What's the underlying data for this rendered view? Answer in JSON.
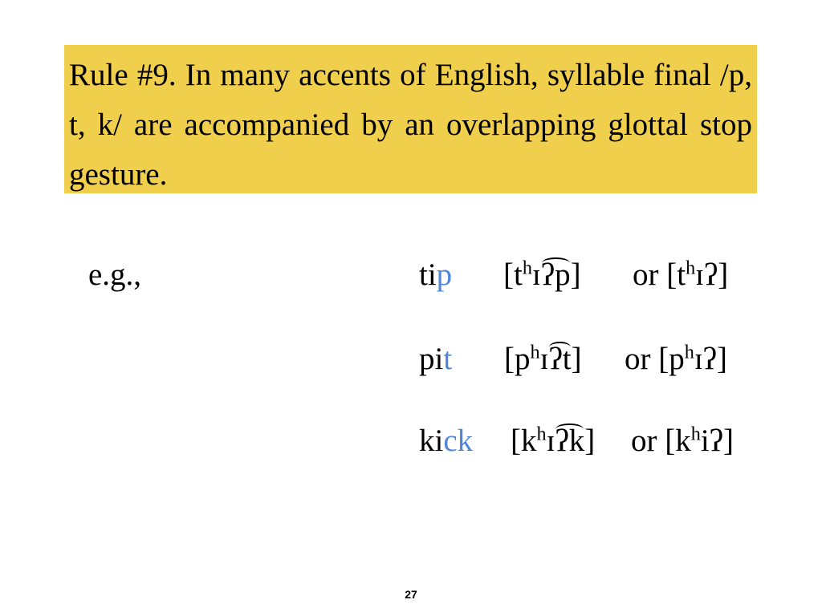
{
  "rule": {
    "text": "Rule #9. In many accents of English, syllable final /p, t, k/ are accompanied by an overlapping glottal stop gesture.",
    "background_color": "#f0cf4c"
  },
  "examples": {
    "label": "e.g.,",
    "highlight_color": "#4f86d8",
    "rows": [
      {
        "word_stem": "ti",
        "word_highlight": "p",
        "ipa": {
          "open": "[t",
          "aspiration": "h",
          "vowel": "ɪ",
          "tied": "ʔp",
          "close": "]"
        },
        "alt": {
          "open": "or [t",
          "aspiration": "h",
          "rest": "ɪʔ]"
        }
      },
      {
        "word_stem": "pi",
        "word_highlight": "t",
        "ipa": {
          "open": "[p",
          "aspiration": "h",
          "vowel": "ɪ",
          "tied": "ʔt",
          "close": "]"
        },
        "alt": {
          "open": "or [p",
          "aspiration": "h",
          "rest": "ɪʔ]"
        }
      },
      {
        "word_stem": "ki",
        "word_highlight": "ck",
        "ipa": {
          "open": "[k",
          "aspiration": "h",
          "vowel": "ɪ",
          "tied": "ʔk",
          "close": "]"
        },
        "alt": {
          "open": "or [k",
          "aspiration": "h",
          "rest": "iʔ]"
        }
      }
    ]
  },
  "footer": {
    "page_number": "27"
  }
}
